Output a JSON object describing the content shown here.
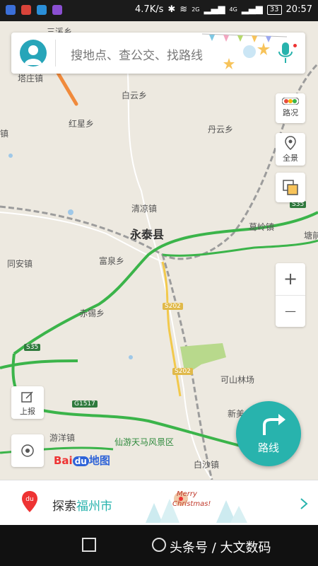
{
  "status_bar": {
    "speed": "4.7K/s",
    "battery": "33",
    "time": "20:57",
    "net_a": "2G",
    "net_b": "4G"
  },
  "search": {
    "placeholder": "搜地点、查公交、找路线"
  },
  "controls": {
    "traffic_label": "路况",
    "panorama_label": "全景",
    "zoom_in": "+",
    "zoom_out": "—",
    "report_label": "上报"
  },
  "route_button": {
    "label": "路线"
  },
  "logo": {
    "baidu": "Bai",
    "du": "du",
    "suffix": "地图"
  },
  "banner": {
    "prefix": "探索",
    "city": "福州市",
    "greeting_line1": "Merry",
    "greeting_line2": "Christmas!"
  },
  "map": {
    "places": {
      "sanxixiang": "三溪乡",
      "tazhuang": "塔庄镇",
      "baiyun": "白云乡",
      "hongxing": "红星乡",
      "danyun": "丹云乡",
      "qingliang": "清凉镇",
      "yongtai": "永泰县",
      "geling": "葛岭镇",
      "tangqian": "塘前",
      "tongan": "同安镇",
      "fuquan": "富泉乡",
      "chixi": "赤锡乡",
      "keshan": "可山林场",
      "xinmei": "新美",
      "youyang": "游洋镇",
      "tianma": "仙游天马风景区",
      "baisha": "白沙镇",
      "zhen_left": "镇"
    },
    "roads": {
      "s35_a": "S35",
      "s35_b": "S35",
      "s202_a": "S202",
      "s202_b": "S202",
      "g1517": "G1517"
    }
  },
  "watermark": "头条号 / 大文数码",
  "colors": {
    "accent": "#28b3ad",
    "highway": "#3bb44a",
    "map_bg": "#ede9e0",
    "arrow": "#f08a3c"
  }
}
